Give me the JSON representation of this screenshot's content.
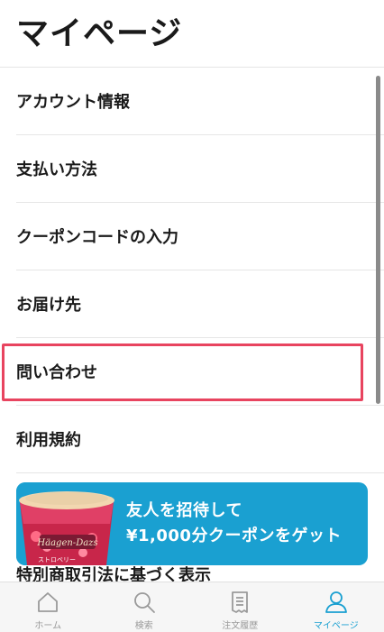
{
  "header": {
    "title": "マイページ"
  },
  "menu": {
    "items": [
      {
        "label": "アカウント情報"
      },
      {
        "label": "支払い方法"
      },
      {
        "label": "クーポンコードの入力"
      },
      {
        "label": "お届け先"
      },
      {
        "label": "問い合わせ",
        "highlighted": true
      },
      {
        "label": "利用規約"
      }
    ],
    "partial_item": "特別商取引法に基づく表示"
  },
  "banner": {
    "line1": "友人を招待して",
    "line2": "¥1,000分クーポンをゲット",
    "product_brand": "Häagen-Dazs",
    "product_flavor": "ストロベリー",
    "background": "#1aa0d1"
  },
  "tabbar": {
    "tabs": [
      {
        "label": "ホーム",
        "icon": "home-icon"
      },
      {
        "label": "検索",
        "icon": "search-icon"
      },
      {
        "label": "注文履歴",
        "icon": "receipt-icon"
      },
      {
        "label": "マイページ",
        "icon": "user-icon",
        "active": true
      }
    ],
    "active_color": "#1aa0d1",
    "inactive_color": "#9a9a9a"
  },
  "highlight_color": "#e8445f"
}
